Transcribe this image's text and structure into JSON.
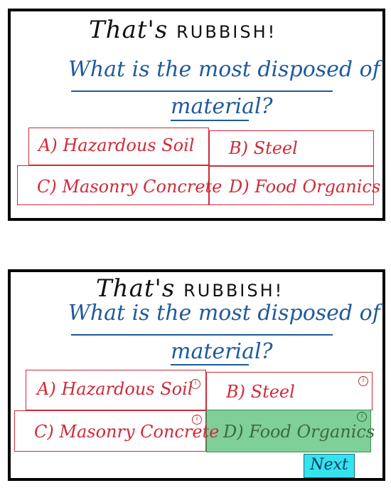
{
  "title": {
    "text1": "That's",
    "text2": "RUBBISH!"
  },
  "question": {
    "line1": "What is the most disposed of",
    "line2": "material?"
  },
  "options": [
    {
      "letter": "A)",
      "label": "Hazardous Soil"
    },
    {
      "letter": "B)",
      "label": "Steel"
    },
    {
      "letter": "C)",
      "label": "Masonry Concrete"
    },
    {
      "letter": "D)",
      "label": "Food Organics"
    }
  ],
  "info_icon": "i",
  "next_label": "Next",
  "colors": {
    "question": "#1f5a9c",
    "options": "#d02a38",
    "correct": "#7fcf99",
    "next": "#35e2f0"
  }
}
